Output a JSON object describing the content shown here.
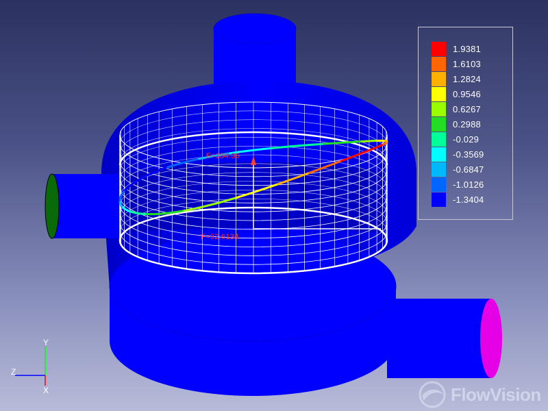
{
  "legend": {
    "entries": [
      {
        "value": "1.9381",
        "color": "#ff0000"
      },
      {
        "value": "1.6103",
        "color": "#ff6600"
      },
      {
        "value": "1.2824",
        "color": "#ffb000"
      },
      {
        "value": "0.9546",
        "color": "#ffff00"
      },
      {
        "value": "0.6267",
        "color": "#99ff00"
      },
      {
        "value": "0.2988",
        "color": "#22dd22"
      },
      {
        "value": "-0.029",
        "color": "#00ff99"
      },
      {
        "value": "-0.3569",
        "color": "#00ffff"
      },
      {
        "value": "-0.6847",
        "color": "#00b8ff"
      },
      {
        "value": "-1.0126",
        "color": "#0066ff"
      },
      {
        "value": "-1.3404",
        "color": "#0000ff"
      }
    ]
  },
  "annotations": {
    "top_marker": "F=184.35",
    "front_marker": "F=92.6134"
  },
  "axes": {
    "y": "Y",
    "z": "Z",
    "x": "X"
  },
  "watermark": {
    "text": "FlowVision"
  },
  "colors": {
    "body": "#0000ff",
    "inlet_left": "#0a6a0a",
    "outlet_right": "#e600e6",
    "cage": "#ffffff"
  }
}
